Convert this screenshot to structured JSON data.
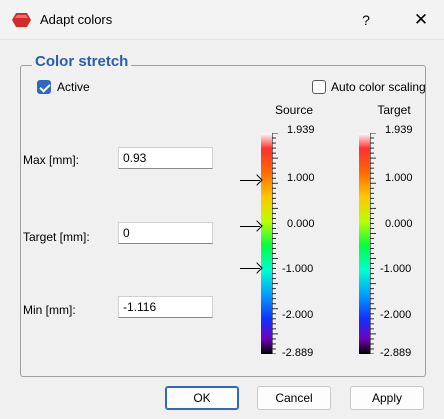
{
  "window": {
    "title": "Adapt colors",
    "help_glyph": "?",
    "close_glyph": "✕",
    "app_icon": "red-hexagon-icon",
    "accent_color": "#2d68c4"
  },
  "group": {
    "title": "Color stretch",
    "title_color": "#2b5cb0"
  },
  "options": {
    "active_label": "Active",
    "active_checked": true,
    "auto_label": "Auto color scaling",
    "auto_checked": false
  },
  "fields": {
    "max_label": "Max [mm]:",
    "max_value": "0.93",
    "target_label": "Target [mm]:",
    "target_value": "0",
    "min_label": "Min [mm]:",
    "min_value": "-1.116"
  },
  "scales": {
    "source_label": "Source",
    "target_label": "Target",
    "source_ticks": [
      "1.939",
      "1.000",
      "0.000",
      "-1.000",
      "-2.000",
      "-2.889"
    ],
    "target_ticks": [
      "1.939",
      "1.000",
      "0.000",
      "-1.000",
      "-2.000",
      "-2.889"
    ]
  },
  "buttons": {
    "ok": "OK",
    "cancel": "Cancel",
    "apply": "Apply"
  }
}
